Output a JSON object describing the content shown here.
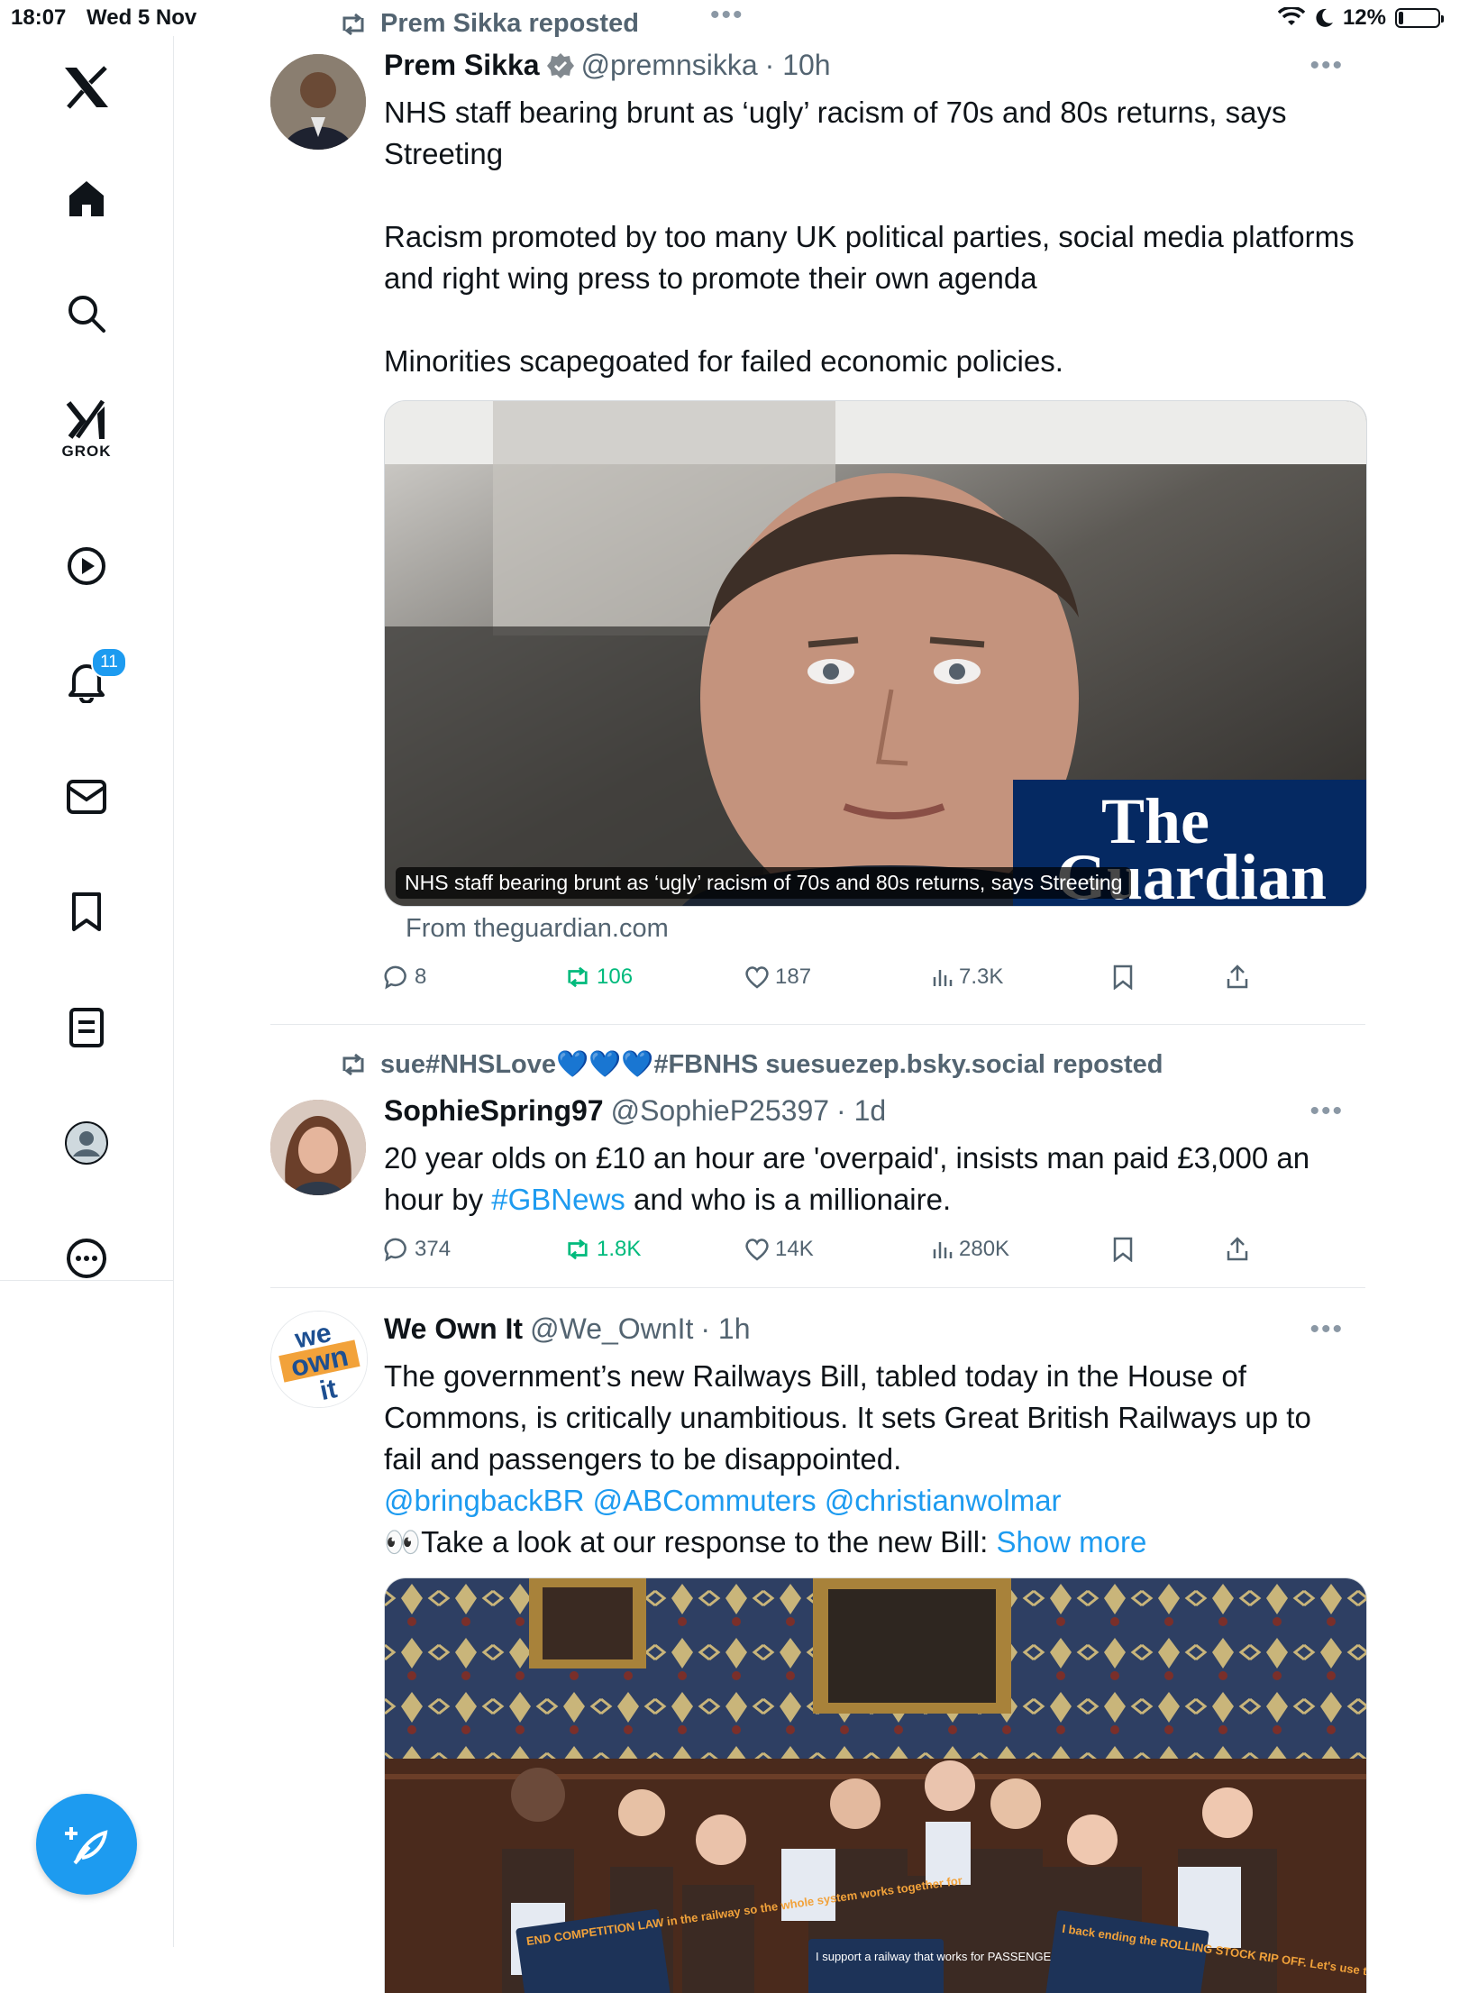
{
  "status_bar": {
    "time": "18:07",
    "date": "Wed 5 Nov",
    "battery_pct": "12%",
    "battery_level": 0.12
  },
  "sidebar": {
    "items": [
      {
        "icon": "x-logo-icon"
      },
      {
        "icon": "home-icon"
      },
      {
        "icon": "search-icon"
      },
      {
        "icon": "grok-icon",
        "label": "GROK"
      },
      {
        "icon": "play-icon"
      },
      {
        "icon": "bell-icon",
        "badge": "11"
      },
      {
        "icon": "mail-icon"
      },
      {
        "icon": "bookmark-icon"
      },
      {
        "icon": "notes-icon"
      },
      {
        "icon": "profile-icon"
      },
      {
        "icon": "more-circle-icon"
      }
    ],
    "compose_icon": "compose-feather-icon"
  },
  "tweets": [
    {
      "repost_by": "Prem Sikka reposted",
      "name": "Prem Sikka",
      "verified": true,
      "handle": "@premnsikka",
      "time": "· 10h",
      "paragraphs": [
        "NHS staff bearing brunt as ‘ugly’ racism of 70s and 80s returns, says Streeting",
        "Racism promoted by too many UK political parties, social media platforms and right wing press to promote their own agenda",
        "Minorities scapegoated for failed economic policies."
      ],
      "card_caption": "NHS staff bearing brunt as ‘ugly’ racism of 70s and 80s returns, says Streeting",
      "card_logo_line1": "The",
      "card_logo_line2": "Guardian",
      "card_source": "From theguardian.com",
      "replies": "8",
      "reposts": "106",
      "likes": "187",
      "views": "7.3K"
    },
    {
      "repost_by": "sue#NHSLove💙💙💙#FBNHS suesuezep.bsky.social reposted",
      "name": "SophieSpring97",
      "handle": "@SophieP25397",
      "time": "· 1d",
      "text_before": "20 year olds on £10 an hour are 'overpaid', insists man paid £3,000 an hour by ",
      "hashtag": "#GBNews",
      "text_after": " and who is a millionaire.",
      "replies": "374",
      "reposts": "1.8K",
      "likes": "14K",
      "views": "280K"
    },
    {
      "name": "We Own It",
      "handle": "@We_OwnIt",
      "time": "· 1h",
      "avatar_text_1": "we",
      "avatar_text_2": "own",
      "avatar_text_3": "it",
      "text": "The government’s new Railways Bill, tabled today in the House of Commons, is critically unambitious. It sets Great British Railways up to fail and passengers to be disappointed.",
      "mentions": "@bringbackBR @ABCommuters @christianwolmar",
      "eyes_text": "👀Take a look at our response to the new Bill: ",
      "show_more": "Show more",
      "signs": [
        "END COMPETITION LAW in the railway so the whole system works together for",
        "I support a railway that works for PASSENGERS NOT PROFIT",
        "I back ending the ROLLING STOCK RIP OFF. Let's use the cash to cut passenger fares"
      ]
    }
  ],
  "colors": {
    "accent": "#1d9bf0",
    "repost_green": "#00ba7c",
    "muted": "#536471",
    "guardian_blue": "#052962"
  }
}
